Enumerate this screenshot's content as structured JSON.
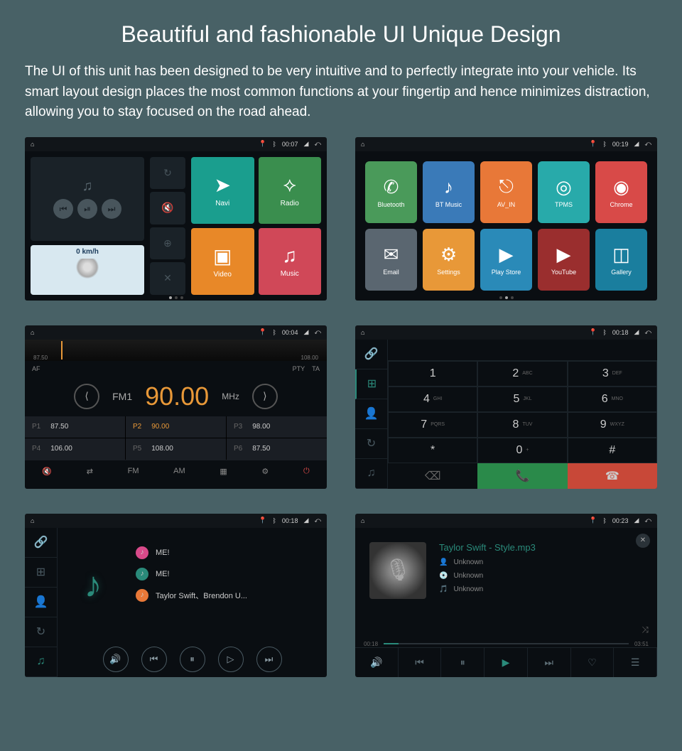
{
  "header": {
    "title": "Beautiful and fashionable UI Unique Design",
    "description": "The UI of this unit has been designed to be very intuitive and to perfectly integrate into your vehicle. Its smart layout design places the most common functions at your fingertip and hence minimizes distraction, allowing you to stay focused on the road ahead."
  },
  "screens": {
    "home": {
      "status": {
        "time": "00:07"
      },
      "speed": "0 km/h",
      "apps": [
        {
          "label": "Navi",
          "icon": "➤"
        },
        {
          "label": "Radio",
          "icon": "⟡"
        },
        {
          "label": "Video",
          "icon": "▣"
        },
        {
          "label": "Music",
          "icon": "♫"
        }
      ],
      "midBtns": [
        "↻",
        "🔇",
        "⊕",
        "✕"
      ]
    },
    "appgrid": {
      "status": {
        "time": "00:19"
      },
      "apps": [
        {
          "label": "Bluetooth",
          "cls": "bluetooth",
          "icon": "✆"
        },
        {
          "label": "BT Music",
          "cls": "btmusic",
          "icon": "♪"
        },
        {
          "label": "AV_IN",
          "cls": "avin",
          "icon": "⎋"
        },
        {
          "label": "TPMS",
          "cls": "tpms",
          "icon": "◎"
        },
        {
          "label": "Chrome",
          "cls": "chrome",
          "icon": "◉"
        },
        {
          "label": "Email",
          "cls": "email",
          "icon": "✉"
        },
        {
          "label": "Settings",
          "cls": "settings",
          "icon": "⚙"
        },
        {
          "label": "Play Store",
          "cls": "playstore",
          "icon": "▶"
        },
        {
          "label": "YouTube",
          "cls": "youtube",
          "icon": "▶"
        },
        {
          "label": "Gallery",
          "cls": "gallery",
          "icon": "◫"
        }
      ]
    },
    "radio": {
      "status": {
        "time": "00:04"
      },
      "dial": {
        "start": "87.50",
        "end": "108.00"
      },
      "tags": {
        "af": "AF",
        "pty": "PTY",
        "ta": "TA"
      },
      "band": "FM1",
      "freq": "90.00",
      "unit": "MHz",
      "presets": [
        {
          "p": "P1",
          "v": "87.50"
        },
        {
          "p": "P2",
          "v": "90.00"
        },
        {
          "p": "P3",
          "v": "98.00"
        },
        {
          "p": "P4",
          "v": "106.00"
        },
        {
          "p": "P5",
          "v": "108.00"
        },
        {
          "p": "P6",
          "v": "87.50"
        }
      ],
      "bottom": [
        "🔇",
        "⇄",
        "FM",
        "AM",
        "▦",
        "⚙",
        "⏻"
      ]
    },
    "dialer": {
      "status": {
        "time": "00:18"
      },
      "keys": [
        {
          "n": "1",
          "s": ""
        },
        {
          "n": "2",
          "s": "ABC"
        },
        {
          "n": "3",
          "s": "DEF"
        },
        {
          "n": "4",
          "s": "GHI"
        },
        {
          "n": "5",
          "s": "JKL"
        },
        {
          "n": "6",
          "s": "MNO"
        },
        {
          "n": "7",
          "s": "PQRS"
        },
        {
          "n": "8",
          "s": "TUV"
        },
        {
          "n": "9",
          "s": "WXYZ"
        },
        {
          "n": "*",
          "s": ""
        },
        {
          "n": "0",
          "s": "+"
        },
        {
          "n": "#",
          "s": ""
        }
      ]
    },
    "btmusic": {
      "status": {
        "time": "00:18"
      },
      "tracks": [
        {
          "icon": "pink",
          "text": "ME!"
        },
        {
          "icon": "teal",
          "text": "ME!"
        },
        {
          "icon": "orange",
          "text": "Taylor Swift、Brendon U..."
        }
      ]
    },
    "player": {
      "status": {
        "time": "00:23"
      },
      "title": "Taylor Swift - Style.mp3",
      "artist": "Unknown",
      "album": "Unknown",
      "genre": "Unknown",
      "elapsed": "00:18",
      "total": "03:51"
    }
  }
}
